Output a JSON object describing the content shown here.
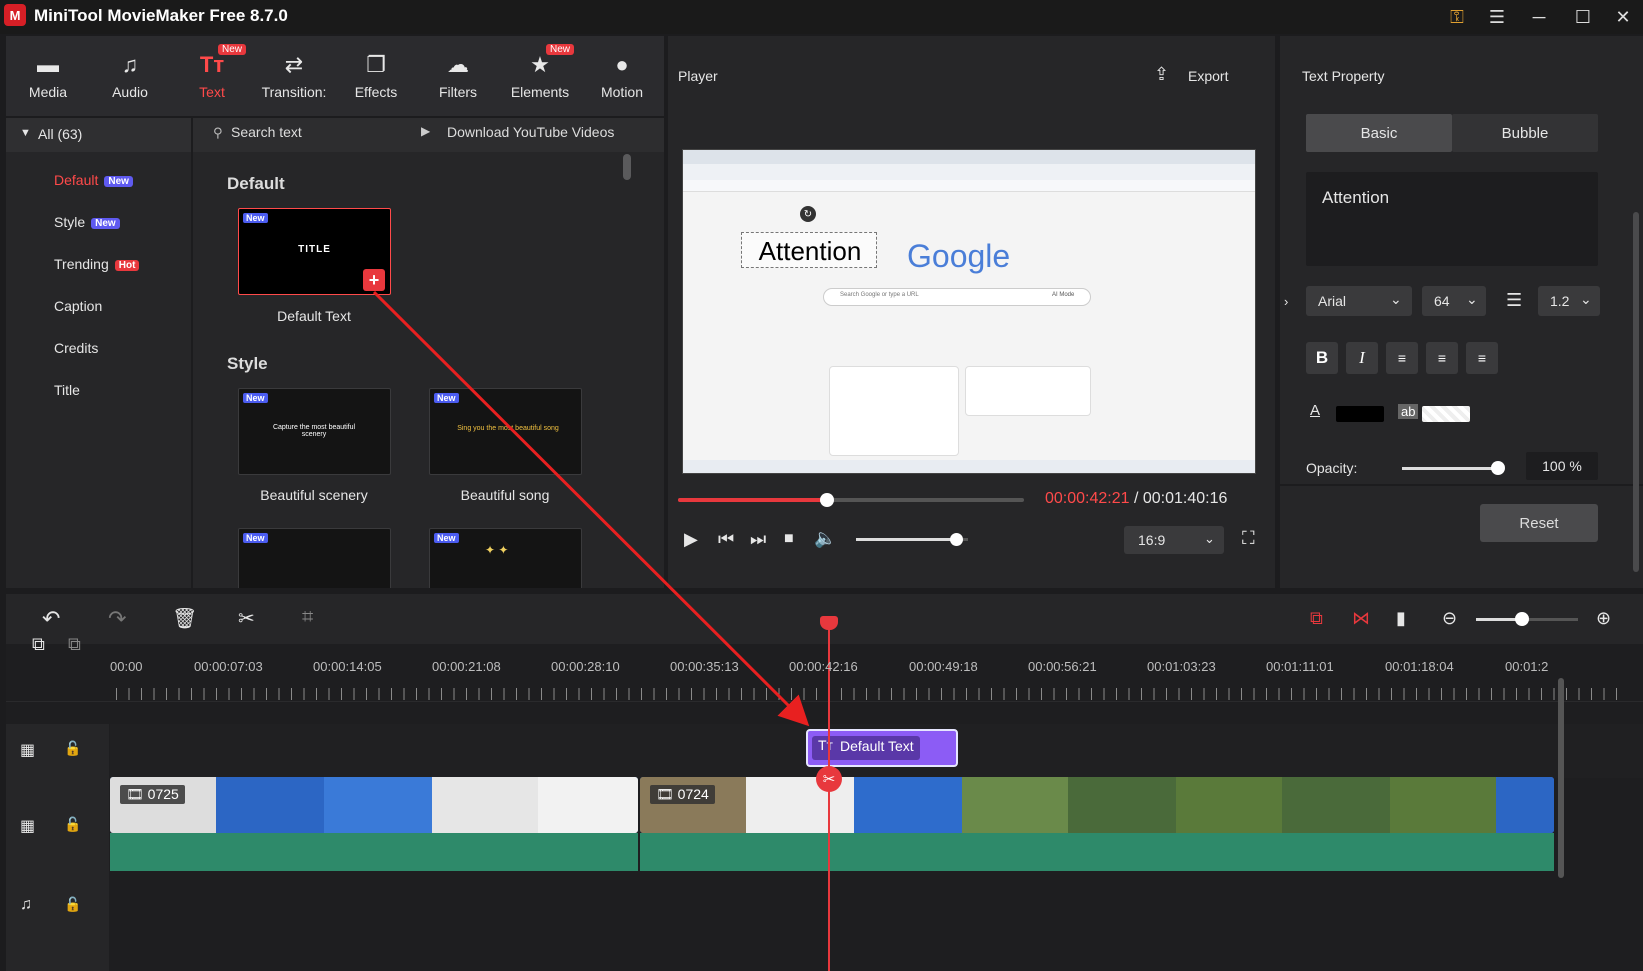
{
  "app": {
    "title": "MiniTool MovieMaker Free 8.7.0"
  },
  "toolbar": {
    "items": [
      {
        "label": "Media",
        "icon": "folder-icon"
      },
      {
        "label": "Audio",
        "icon": "music-note-icon"
      },
      {
        "label": "Text",
        "icon": "text-icon",
        "badge": "New",
        "active": true
      },
      {
        "label": "Transition:",
        "icon": "transition-arrows-icon"
      },
      {
        "label": "Effects",
        "icon": "effects-icon"
      },
      {
        "label": "Filters",
        "icon": "filters-icon"
      },
      {
        "label": "Elements",
        "icon": "elements-icon",
        "badge": "New"
      },
      {
        "label": "Motion",
        "icon": "motion-icon"
      }
    ]
  },
  "categories": {
    "all_label": "All (63)",
    "items": [
      {
        "label": "Default",
        "badge": "New",
        "active": true
      },
      {
        "label": "Style",
        "badge": "New"
      },
      {
        "label": "Trending",
        "badge": "Hot"
      },
      {
        "label": "Caption"
      },
      {
        "label": "Credits"
      },
      {
        "label": "Title"
      }
    ]
  },
  "content": {
    "search_placeholder": "Search text",
    "download_link": "Download YouTube Videos",
    "section_default": "Default",
    "section_style": "Style",
    "new_tag": "New",
    "default_thumb_text": "TITLE",
    "default_item_label": "Default Text",
    "style_items": [
      {
        "label": "Beautiful scenery",
        "thumb_text": "Capture the most beautiful scenery"
      },
      {
        "label": "Beautiful song",
        "thumb_text": "Sing you the most beautiful song"
      }
    ]
  },
  "player": {
    "title": "Player",
    "export_label": "Export",
    "current_time": "00:00:42:21",
    "separator": " / ",
    "total_time": "00:01:40:16",
    "progress": 0.43,
    "volume": 0.9,
    "aspect": "16:9",
    "preview": {
      "overlay_text": "Attention",
      "logo_text": "Google",
      "search_placeholder": "Search Google or type a URL",
      "ai_mode": "AI Mode"
    }
  },
  "property": {
    "title": "Text Property",
    "tabs": [
      "Basic",
      "Bubble"
    ],
    "active_tab": "Basic",
    "text_value": "Attention",
    "font": "Arial",
    "size": "64",
    "line_spacing": "1.2",
    "opacity_label": "Opacity:",
    "opacity_value": "100 %",
    "opacity": 1.0,
    "text_color": "#000000",
    "bg_glyph": "ab",
    "reset_label": "Reset"
  },
  "timeline": {
    "ticks": [
      "00:00",
      "00:00:07:03",
      "00:00:14:05",
      "00:00:21:08",
      "00:00:28:10",
      "00:00:35:13",
      "00:00:42:16",
      "00:00:49:18",
      "00:00:56:21",
      "00:01:03:23",
      "00:01:11:01",
      "00:01:18:04",
      "00:01:2"
    ],
    "text_clip_label": "Default Text",
    "video_clips": [
      {
        "label": "0725"
      },
      {
        "label": "0724"
      }
    ],
    "zoom": 0.45
  },
  "colors": {
    "accent": "#ff4a4a",
    "text_clip": "#8c5cf5",
    "audio_track": "#2e8a6a",
    "playhead": "#e8383d"
  }
}
